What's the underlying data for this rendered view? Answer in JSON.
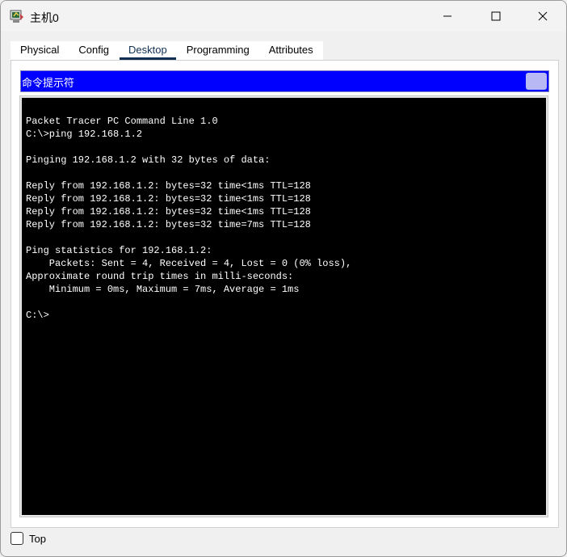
{
  "window": {
    "title": "主机0",
    "icon": "packet-tracer-pc-icon"
  },
  "tabs": [
    {
      "label": "Physical",
      "active": false
    },
    {
      "label": "Config",
      "active": false
    },
    {
      "label": "Desktop",
      "active": true
    },
    {
      "label": "Programming",
      "active": false
    },
    {
      "label": "Attributes",
      "active": false
    }
  ],
  "command_prompt": {
    "title": "命令提示符",
    "output": [
      "",
      "Packet Tracer PC Command Line 1.0",
      "C:\\>ping 192.168.1.2",
      "",
      "Pinging 192.168.1.2 with 32 bytes of data:",
      "",
      "Reply from 192.168.1.2: bytes=32 time<1ms TTL=128",
      "Reply from 192.168.1.2: bytes=32 time<1ms TTL=128",
      "Reply from 192.168.1.2: bytes=32 time<1ms TTL=128",
      "Reply from 192.168.1.2: bytes=32 time=7ms TTL=128",
      "",
      "Ping statistics for 192.168.1.2:",
      "    Packets: Sent = 4, Received = 4, Lost = 0 (0% loss),",
      "Approximate round trip times in milli-seconds:",
      "    Minimum = 0ms, Maximum = 7ms, Average = 1ms",
      "",
      "C:\\>"
    ]
  },
  "footer": {
    "top_label": "Top",
    "top_checked": false
  },
  "colors": {
    "cmd_header": "#0000ff",
    "terminal_bg": "#000000",
    "terminal_fg": "#ffffff",
    "active_tab": "#0f2f52"
  }
}
